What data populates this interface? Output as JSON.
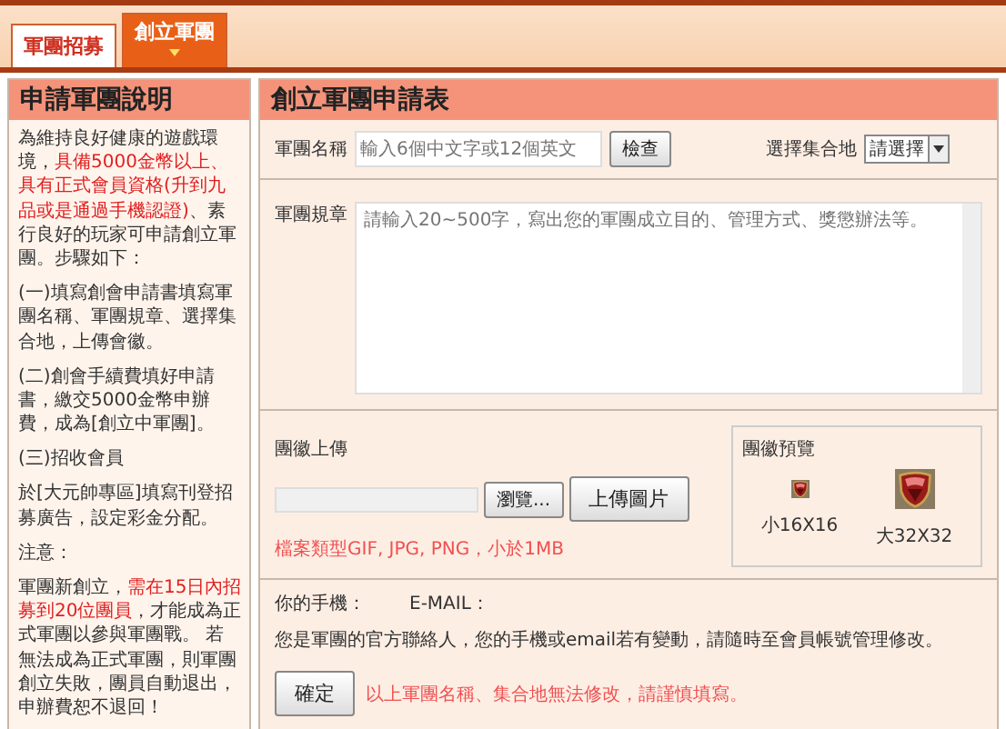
{
  "tabs": [
    {
      "label": "軍團招募",
      "selected": false
    },
    {
      "label": "創立軍團",
      "selected": true
    }
  ],
  "sidebar": {
    "title": "申請軍團說明",
    "paragraphs": [
      {
        "parts": [
          {
            "text": "為維持良好健康的遊戲環境，",
            "highlight": false
          },
          {
            "text": "具備5000金幣以上、具有正式會員資格(升到九品或是通過手機認證)",
            "highlight": true
          },
          {
            "text": "、素行良好的玩家可申請創立軍團。步驟如下：",
            "highlight": false
          }
        ]
      },
      {
        "parts": [
          {
            "text": "(一)填寫創會申請書填寫軍團名稱、軍團規章、選擇集合地，上傳會徽。",
            "highlight": false
          }
        ]
      },
      {
        "parts": [
          {
            "text": "(二)創會手續費填好申請書，繳交5000金幣申辦費，成為[創立中軍團]。",
            "highlight": false
          }
        ]
      },
      {
        "parts": [
          {
            "text": "(三)招收會員",
            "highlight": false
          }
        ]
      },
      {
        "parts": [
          {
            "text": "於[大元帥專區]填寫刊登招募廣告，設定彩金分配。",
            "highlight": false
          }
        ]
      },
      {
        "parts": [
          {
            "text": "注意：",
            "highlight": false
          }
        ]
      },
      {
        "parts": [
          {
            "text": "軍團新創立，",
            "highlight": false
          },
          {
            "text": "需在15日內招募到20位團員",
            "highlight": true
          },
          {
            "text": "，才能成為正式軍團以參與軍團戰。 若無法成為正式軍團，則軍團創立失敗，團員自動退出，申辦費恕不退回！",
            "highlight": false
          }
        ]
      }
    ]
  },
  "form": {
    "title": "創立軍團申請表",
    "name_label": "軍團名稱",
    "name_placeholder": "輸入6個中文字或12個英文",
    "check_button": "檢查",
    "location_label": "選擇集合地",
    "location_value": "請選擇",
    "rules_label": "軍團規章",
    "rules_placeholder": "請輸入20~500字，寫出您的軍團成立目的、管理方式、獎懲辦法等。",
    "upload_label": "團徽上傳",
    "browse_button": "瀏覽...",
    "upload_button": "上傳圖片",
    "upload_hint": "檔案類型GIF, JPG, PNG，小於1MB",
    "preview_title": "團徽預覽",
    "preview_small": "小16X16",
    "preview_large": "大32X32",
    "phone_label": "你的手機：",
    "email_label": "E-MAIL：",
    "contact_note": "您是軍團的官方聯絡人，您的手機或email若有變動，請隨時至會員帳號管理修改。",
    "confirm_button": "確定",
    "confirm_note": "以上軍團名稱、集合地無法修改，請謹慎填寫。"
  }
}
